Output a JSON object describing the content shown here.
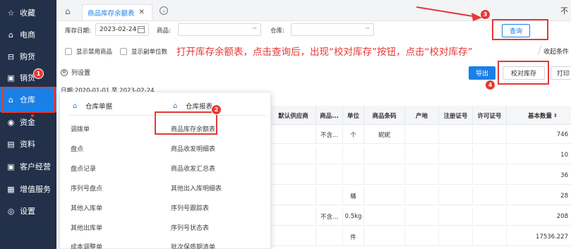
{
  "sidebar": {
    "items": [
      {
        "label": "收藏",
        "icon": "star-icon",
        "glyph": "☆"
      },
      {
        "label": "电商",
        "icon": "store-icon",
        "glyph": "⌂"
      },
      {
        "label": "购货",
        "icon": "cart-icon",
        "glyph": "⊟"
      },
      {
        "label": "销货",
        "icon": "invoice-icon",
        "glyph": "▣"
      },
      {
        "label": "仓库",
        "icon": "warehouse-icon",
        "glyph": "⌂"
      },
      {
        "label": "资金",
        "icon": "money-icon",
        "glyph": "◉"
      },
      {
        "label": "资料",
        "icon": "profile-icon",
        "glyph": "▤"
      },
      {
        "label": "客户经营",
        "icon": "customer-icon",
        "glyph": "▣"
      },
      {
        "label": "增值服务",
        "icon": "service-icon",
        "glyph": "▦"
      },
      {
        "label": "设置",
        "icon": "settings-icon",
        "glyph": "◎"
      }
    ],
    "badge1": "1"
  },
  "tabs": {
    "active": "商品库存余额表",
    "close": "✕",
    "more": "⌄",
    "pin": "不"
  },
  "filters": {
    "date_label": "库存日期:",
    "date_value": "2023-02-24",
    "product_label": "商品:",
    "warehouse_label": "仓库:",
    "ellipsis": "···",
    "query_button": "查询",
    "show_disabled": "显示禁用商品",
    "show_sub_unit": "显示副单位数",
    "collapse": "收起条件"
  },
  "annotation": "打开库存余额表，点击查询后，出现“校对库存”按钮，点击“校对库存”",
  "badges": {
    "b2": "2",
    "b3": "3",
    "b4": "4"
  },
  "toolbar": {
    "column_settings": "列设置",
    "export": "导出",
    "check_inventory": "校对库存",
    "print": "打印",
    "date_range": "日期:2020-01-01 至 2023-02-24"
  },
  "menu": {
    "col1_title": "仓库单据",
    "col2_title": "仓库报表",
    "col1_items": [
      "调拨单",
      "盘点",
      "盘点记录",
      "序列号盘点",
      "其他入库单",
      "其他出库单",
      "成本调整单"
    ],
    "col2_items": [
      "商品库存余额表",
      "商品收发明细表",
      "商品收发汇总表",
      "其他出入库明细表",
      "序列号跟踪表",
      "序列号状态表",
      "批次保质期清单"
    ]
  },
  "table": {
    "headers": [
      "默认供应商",
      "商品...",
      "单位",
      "商品条码",
      "产地",
      "注册证号",
      "许可证号",
      "基本数量"
    ],
    "rows": [
      [
        "",
        "不含...",
        "个",
        "妮妮",
        "",
        "",
        "",
        "746"
      ],
      [
        "",
        "",
        "",
        "",
        "",
        "",
        "",
        "10"
      ],
      [
        "",
        "",
        "",
        "",
        "",
        "",
        "",
        "36"
      ],
      [
        "",
        "",
        "桶",
        "",
        "",
        "",
        "",
        "28"
      ],
      [
        "",
        "不含...",
        "0.5kg",
        "",
        "",
        "",
        "",
        "208"
      ],
      [
        "",
        "",
        "件",
        "",
        "",
        "",
        "",
        "17536.227"
      ]
    ]
  },
  "colors": {
    "sidebar_bg": "#22304a",
    "accent": "#1a80e6",
    "annotation_red": "#e53935"
  }
}
